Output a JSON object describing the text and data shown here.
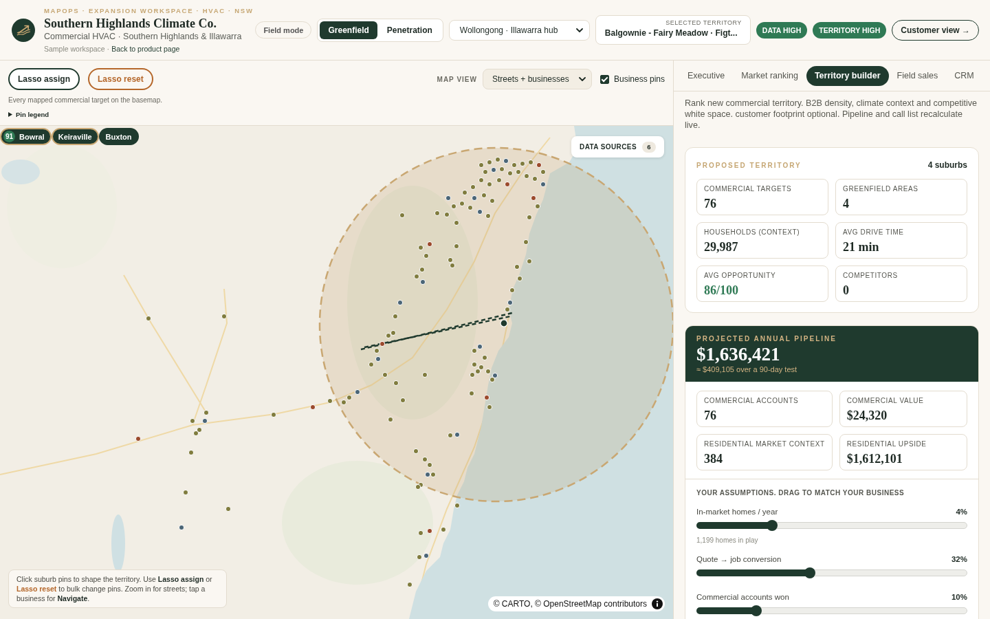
{
  "header": {
    "eyebrow": "MAPOPS · EXPANSION WORKSPACE · HVAC · NSW",
    "title": "Southern Highlands Climate Co.",
    "subtitle": "Commercial HVAC · Southern Highlands & Illawarra",
    "workspace_note": "Sample workspace ·",
    "back_link": "Back to product page"
  },
  "toolbar": {
    "field_mode": "Field mode",
    "modes": [
      {
        "label": "Greenfield",
        "selected": true
      },
      {
        "label": "Penetration",
        "selected": false
      }
    ],
    "hub": "Wollongong · Illawarra hub",
    "selected_territory": {
      "label": "SELECTED TERRITORY",
      "value": "Balgownie - Fairy Meadow · Figt..."
    },
    "badges": [
      "DATA HIGH",
      "TERRITORY HIGH"
    ],
    "customer_view": "Customer view →"
  },
  "map": {
    "lasso_buttons": [
      {
        "label": "Lasso assign",
        "kind": "assign"
      },
      {
        "label": "Lasso reset",
        "kind": "reset"
      }
    ],
    "map_view": {
      "label": "MAP VIEW",
      "value": "Streets + businesses"
    },
    "business_pins": {
      "label": "Business pins",
      "checked": true
    },
    "caption": "Every mapped commercial target on the basemap.",
    "legend_toggle": {
      "label": "Pin legend",
      "expanded": false
    },
    "suburb_chips": [
      {
        "score": "91",
        "label": "Bowral",
        "selected": true
      },
      {
        "label": "Keiraville",
        "selected": true
      },
      {
        "label": "Buxton",
        "selected": false
      }
    ],
    "data_sources": {
      "label": "DATA SOURCES",
      "count": "6"
    },
    "hint": [
      {
        "kind": "plain",
        "text": "Click suburb pins to shape the territory. Use "
      },
      {
        "kind": "strong",
        "text": "Lasso assign"
      },
      {
        "kind": "plain",
        "text": " or "
      },
      {
        "kind": "accent",
        "text": "Lasso reset"
      },
      {
        "kind": "plain",
        "text": " to bulk change pins. Zoom in for streets; tap a business for "
      },
      {
        "kind": "strong",
        "text": "Navigate"
      },
      {
        "kind": "plain",
        "text": "."
      }
    ],
    "attribution": "© CARTO, © OpenStreetMap contributors"
  },
  "tabs": [
    {
      "label": "Executive",
      "selected": false
    },
    {
      "label": "Market ranking",
      "selected": false
    },
    {
      "label": "Territory builder",
      "selected": true
    },
    {
      "label": "Field sales",
      "selected": false
    },
    {
      "label": "CRM",
      "selected": false
    }
  ],
  "intro": "Rank new commercial territory. B2B density, climate context and competitive white space. customer footprint optional. Pipeline and call list recalculate live.",
  "proposed_territory": {
    "title": "PROPOSED TERRITORY",
    "count": "4 suburbs",
    "stats": [
      {
        "label": "COMMERCIAL TARGETS",
        "value": "76",
        "kind": "plain"
      },
      {
        "label": "GREENFIELD AREAS",
        "value": "4",
        "kind": "plain"
      },
      {
        "label": "HOUSEHOLDS (CONTEXT)",
        "value": "29,987",
        "kind": "plain"
      },
      {
        "label": "AVG DRIVE TIME",
        "value": "21 min",
        "kind": "plain"
      },
      {
        "label": "AVG OPPORTUNITY",
        "value": "86/100",
        "kind": "positive"
      },
      {
        "label": "COMPETITORS",
        "value": "0",
        "kind": "plain"
      }
    ]
  },
  "pipeline": {
    "title": "PROJECTED ANNUAL PIPELINE",
    "total": "$1,636,421",
    "test_note": "≈ $409,105 over a 90-day test",
    "stats": [
      {
        "label": "COMMERCIAL ACCOUNTS",
        "value": "76"
      },
      {
        "label": "COMMERCIAL VALUE",
        "value": "$24,320"
      },
      {
        "label": "RESIDENTIAL MARKET CONTEXT",
        "value": "384"
      },
      {
        "label": "RESIDENTIAL UPSIDE",
        "value": "$1,612,101"
      }
    ],
    "assumptions_title": "YOUR ASSUMPTIONS. DRAG TO MATCH YOUR BUSINESS",
    "sliders": [
      {
        "label": "In-market homes / year",
        "reading": "4%",
        "level": 0.28,
        "note": "1,199 homes in play"
      },
      {
        "label": "Quote → job conversion",
        "reading": "32%",
        "level": 0.42
      },
      {
        "label": "Commercial accounts won",
        "reading": "10%",
        "level": 0.22
      }
    ]
  }
}
